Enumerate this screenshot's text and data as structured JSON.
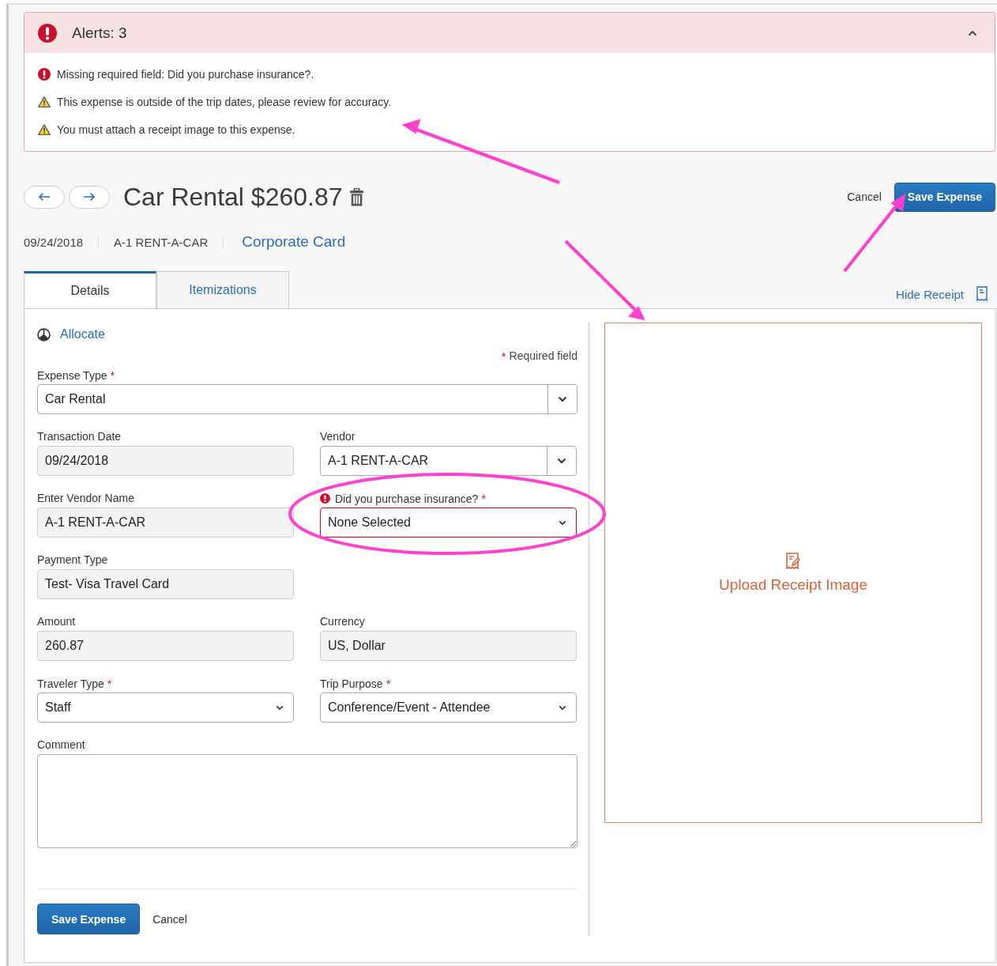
{
  "alerts": {
    "title": "Alerts: 3",
    "expanded": true,
    "items": [
      {
        "kind": "error",
        "text": "Missing required field: Did you purchase insurance?."
      },
      {
        "kind": "warning",
        "text": "This expense is outside of the trip dates, please review for accuracy."
      },
      {
        "kind": "warning",
        "text": "You must attach a receipt image to this expense."
      }
    ]
  },
  "header": {
    "title": "Car Rental $260.87",
    "cancel": "Cancel",
    "save": "Save Expense"
  },
  "meta": {
    "date": "09/24/2018",
    "vendor": "A-1 RENT-A-CAR",
    "payment_link": "Corporate Card"
  },
  "tabs": [
    {
      "label": "Details",
      "selected": true
    },
    {
      "label": "Itemizations",
      "selected": false
    }
  ],
  "hide_receipt": "Hide Receipt",
  "form": {
    "allocate": "Allocate",
    "required_mark": "*",
    "required_note": "Required field",
    "rows": [
      {
        "fields": [
          {
            "kind": "combo",
            "label": "Expense Type",
            "required": true,
            "error": false,
            "value": "Car Rental"
          }
        ]
      },
      {
        "fields": [
          {
            "kind": "readonly",
            "label": "Transaction Date",
            "required": false,
            "error": false,
            "value": "09/24/2018"
          },
          {
            "kind": "combo",
            "label": "Vendor",
            "required": false,
            "error": false,
            "value": "A-1 RENT-A-CAR"
          }
        ]
      },
      {
        "fields": [
          {
            "kind": "readonly",
            "label": "Enter Vendor Name",
            "required": false,
            "error": false,
            "value": "A-1 RENT-A-CAR"
          },
          {
            "kind": "select",
            "label": "Did you purchase insurance?",
            "required": true,
            "error": true,
            "value": "None Selected"
          }
        ]
      },
      {
        "fields": [
          {
            "kind": "readonly",
            "label": "Payment Type",
            "required": false,
            "error": false,
            "value": "Test- Visa Travel Card"
          }
        ]
      },
      {
        "fields": [
          {
            "kind": "readonly",
            "label": "Amount",
            "required": false,
            "error": false,
            "value": "260.87"
          },
          {
            "kind": "readonly",
            "label": "Currency",
            "required": false,
            "error": false,
            "value": "US, Dollar"
          }
        ]
      },
      {
        "fields": [
          {
            "kind": "select",
            "label": "Traveler Type",
            "required": true,
            "error": false,
            "value": "Staff"
          },
          {
            "kind": "select",
            "label": "Trip Purpose",
            "required": true,
            "error": false,
            "value": "Conference/Event - Attendee"
          }
        ]
      },
      {
        "fields": [
          {
            "kind": "textarea",
            "label": "Comment",
            "required": false,
            "error": false
          }
        ]
      }
    ]
  },
  "receipt": {
    "upload": "Upload Receipt Image"
  },
  "footer": {
    "save": "Save Expense",
    "cancel": "Cancel"
  }
}
